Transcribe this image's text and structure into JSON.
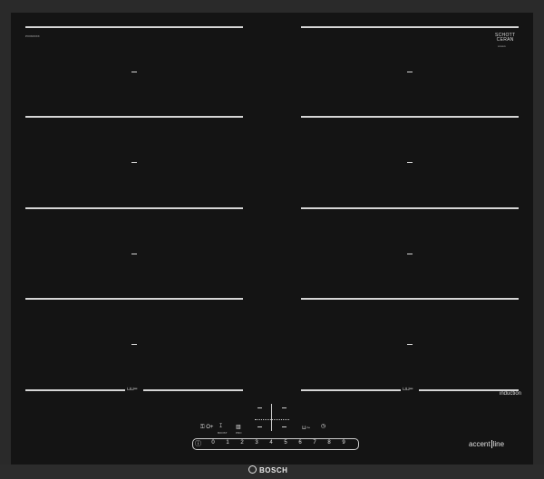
{
  "branding": {
    "model_code": "PXX6XXXX",
    "glass_maker_line1": "SCHOTT",
    "glass_maker_line2": "CERAN",
    "glass_maker_sub": "xxxxxxx",
    "brand": "BOSCH",
    "series": "induction",
    "line_left": "accent",
    "line_right": "line"
  },
  "zones": {
    "mark": "–",
    "flex_icon": "⊔⊔═"
  },
  "controls": {
    "buttons": [
      {
        "icon": "⚿ O+",
        "label": ""
      },
      {
        "icon": "ꕯ",
        "label": "BOOST"
      },
      {
        "icon": "▥",
        "label": "PRO"
      },
      {
        "icon": "⊔∼",
        "label": ""
      },
      {
        "icon": "◷",
        "label": ""
      }
    ],
    "power_icon": "ⓘ",
    "slider_values": [
      "0",
      "1",
      "2",
      "3",
      "4",
      "5",
      "6",
      "7",
      "8",
      "9"
    ],
    "display_dashes": [
      "–",
      "–",
      "–",
      "–"
    ]
  }
}
